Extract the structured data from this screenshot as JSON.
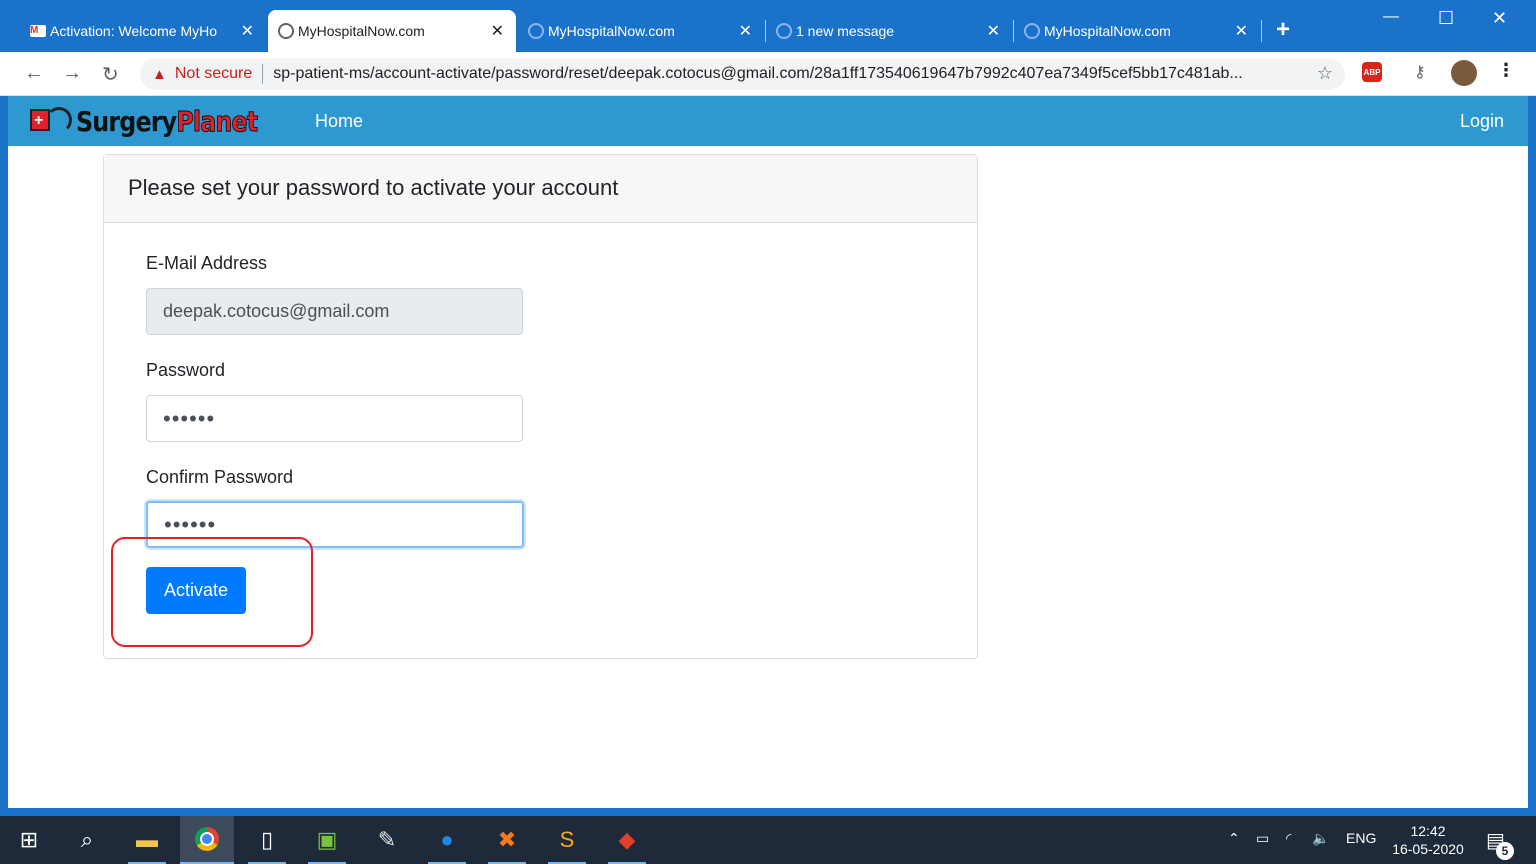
{
  "browser": {
    "tabs": [
      {
        "title": "Activation: Welcome MyHo",
        "icon": "gmail-icon",
        "active": false
      },
      {
        "title": "MyHospitalNow.com",
        "icon": "globe-icon",
        "active": true
      },
      {
        "title": "MyHospitalNow.com",
        "icon": "globe-icon",
        "active": false
      },
      {
        "title": "1 new message",
        "icon": "globe-icon",
        "active": false
      },
      {
        "title": "MyHospitalNow.com",
        "icon": "globe-icon",
        "active": false
      }
    ],
    "security_label": "Not secure",
    "url": "sp-patient-ms/account-activate/password/reset/deepak.cotocus@gmail.com/28a1ff173540619647b7992c407ea7349f5cef5bb17c481ab...",
    "abp_label": "ABP"
  },
  "site": {
    "brand_part1": "Surgery",
    "brand_part2": "Planet",
    "nav_home": "Home",
    "nav_login": "Login"
  },
  "form": {
    "title": "Please set your password to activate your account",
    "email_label": "E-Mail Address",
    "email_value": "deepak.cotocus@gmail.com",
    "password_label": "Password",
    "password_value": "••••••",
    "confirm_label": "Confirm Password",
    "confirm_value": "••••••",
    "submit_label": "Activate"
  },
  "taskbar": {
    "language": "ENG",
    "time": "12:42",
    "date": "16-05-2020",
    "notification_count": "5"
  },
  "colors": {
    "chrome_blue": "#1a73c9",
    "navbar_blue": "#2e98d0",
    "button_blue": "#007bff",
    "brand_red": "#e0202a",
    "highlight_red": "#e0202a"
  }
}
